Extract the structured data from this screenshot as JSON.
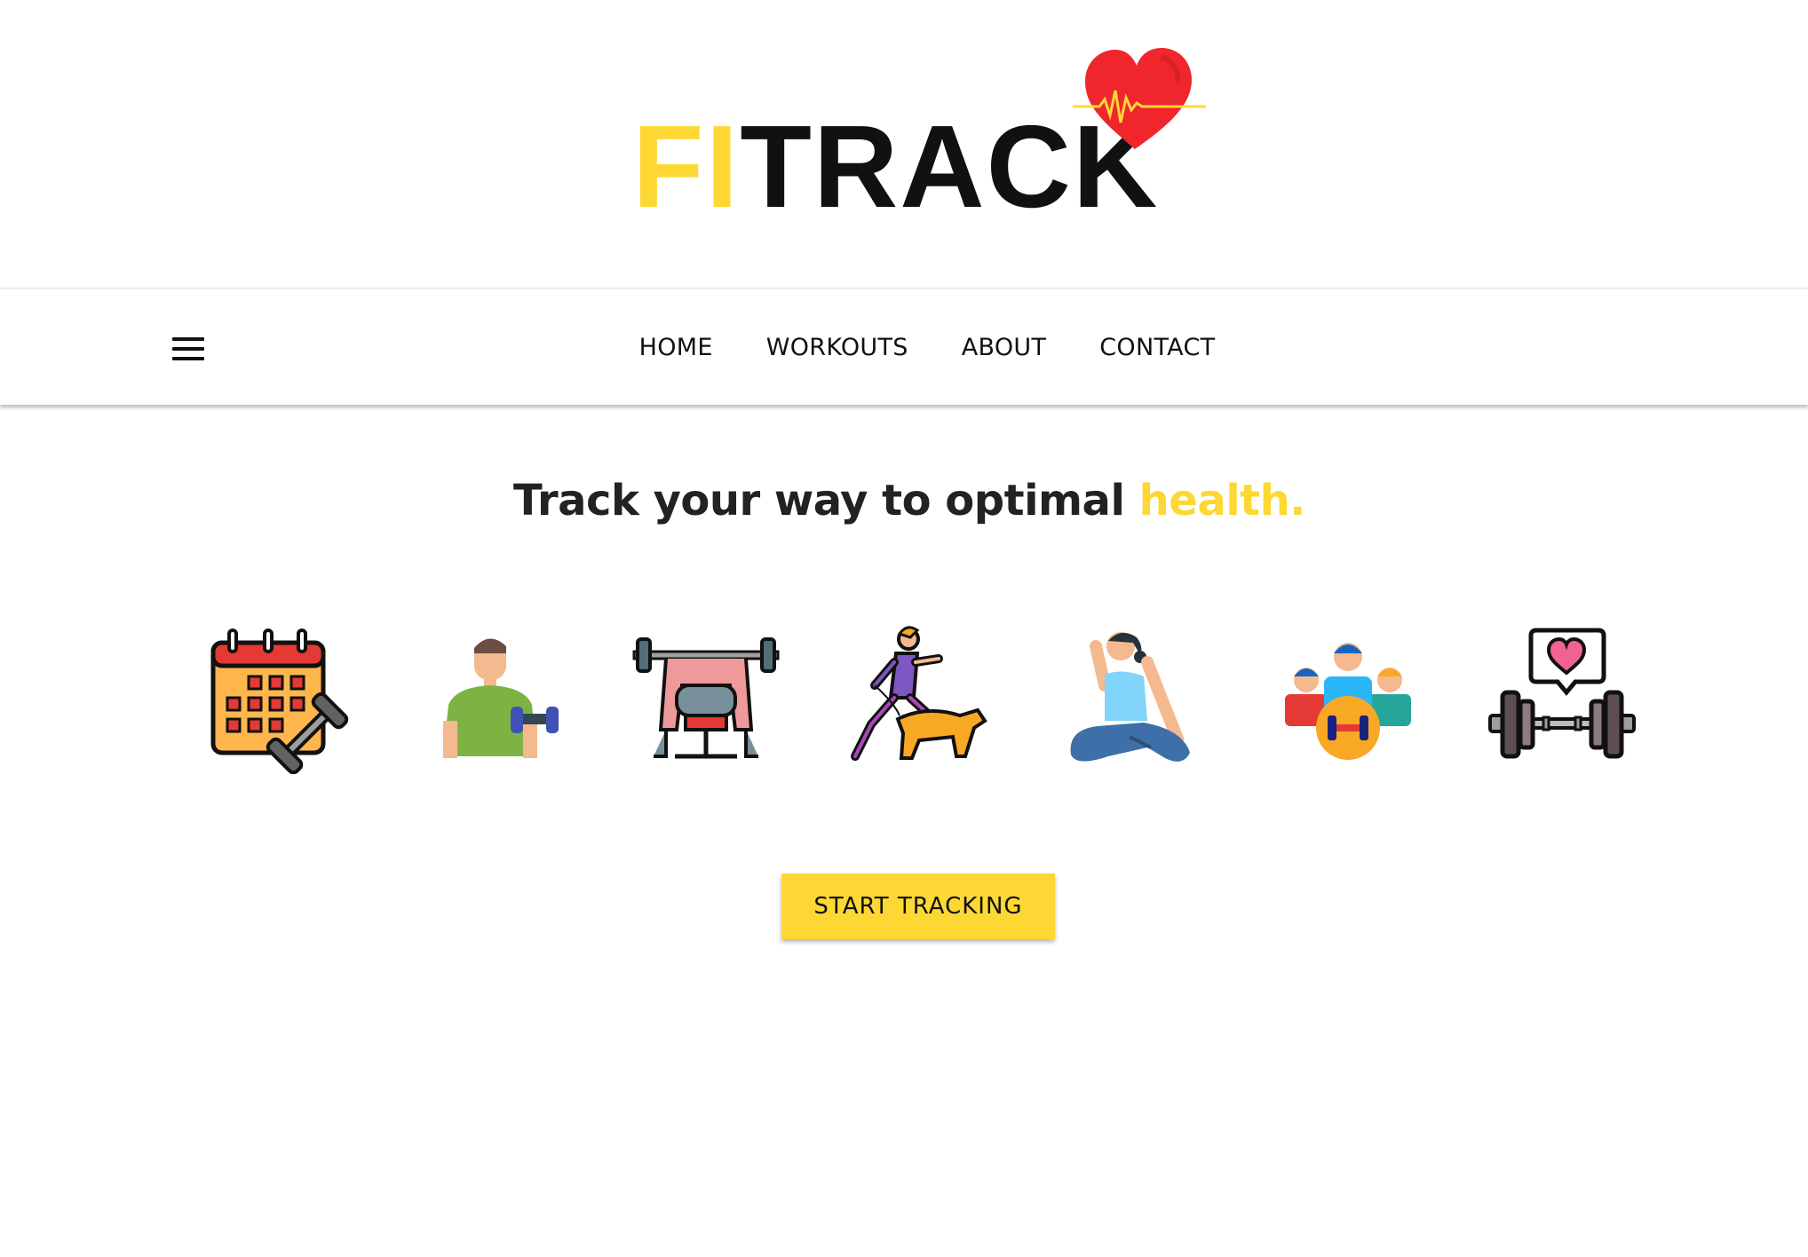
{
  "brand": {
    "logo_part1": "FI",
    "logo_part2": "TRACK",
    "accent_color": "#fdd835",
    "heart_color": "#f0262c"
  },
  "nav": {
    "menu_icon": "hamburger-menu-icon",
    "links": [
      "HOME",
      "WORKOUTS",
      "ABOUT",
      "CONTACT"
    ]
  },
  "hero": {
    "tagline_main": "Track your way to optimal ",
    "tagline_accent": "health.",
    "icons": [
      "calendar-dumbbell-icon",
      "man-lifting-dumbbell-icon",
      "bench-press-icon",
      "woman-running-with-dog-icon",
      "yoga-pose-icon",
      "group-fitness-icon",
      "barbell-heart-icon"
    ],
    "cta_label": "START TRACKING"
  }
}
